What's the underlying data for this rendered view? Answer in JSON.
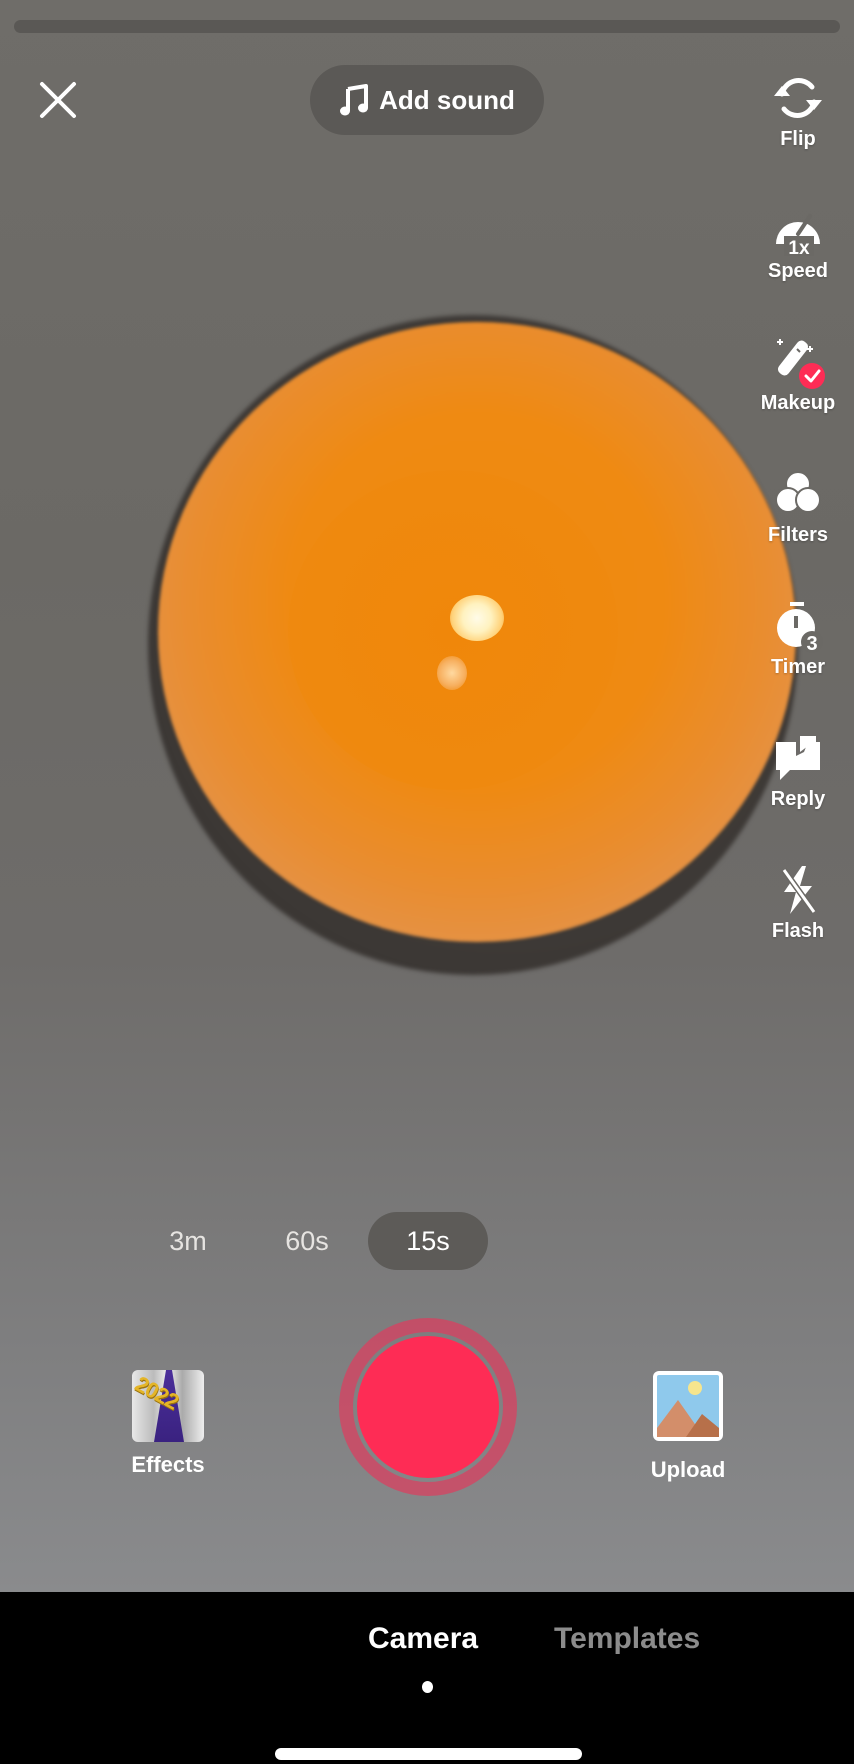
{
  "top": {
    "close_icon": "close-icon",
    "add_sound_label": "Add sound",
    "music_icon": "music-note-icon",
    "recording_progress": 0
  },
  "side_tools": [
    {
      "label": "Flip",
      "icon": "flip-camera-icon"
    },
    {
      "label": "Speed",
      "icon": "speed-gauge-icon",
      "badge": "1x"
    },
    {
      "label": "Makeup",
      "icon": "makeup-wand-icon",
      "active": true
    },
    {
      "label": "Filters",
      "icon": "filters-icon"
    },
    {
      "label": "Timer",
      "icon": "timer-icon",
      "badge": "3"
    },
    {
      "label": "Reply",
      "icon": "reply-icon"
    },
    {
      "label": "Flash",
      "icon": "flash-off-icon"
    }
  ],
  "durations": {
    "options": [
      "3m",
      "60s",
      "15s"
    ],
    "selected": "15s"
  },
  "capture": {
    "effects_label": "Effects",
    "effects_thumb_text": "2022",
    "upload_label": "Upload",
    "record_color": "#fe2c55"
  },
  "bottom_tabs": {
    "items": [
      "Camera",
      "Templates"
    ],
    "selected": "Camera"
  }
}
